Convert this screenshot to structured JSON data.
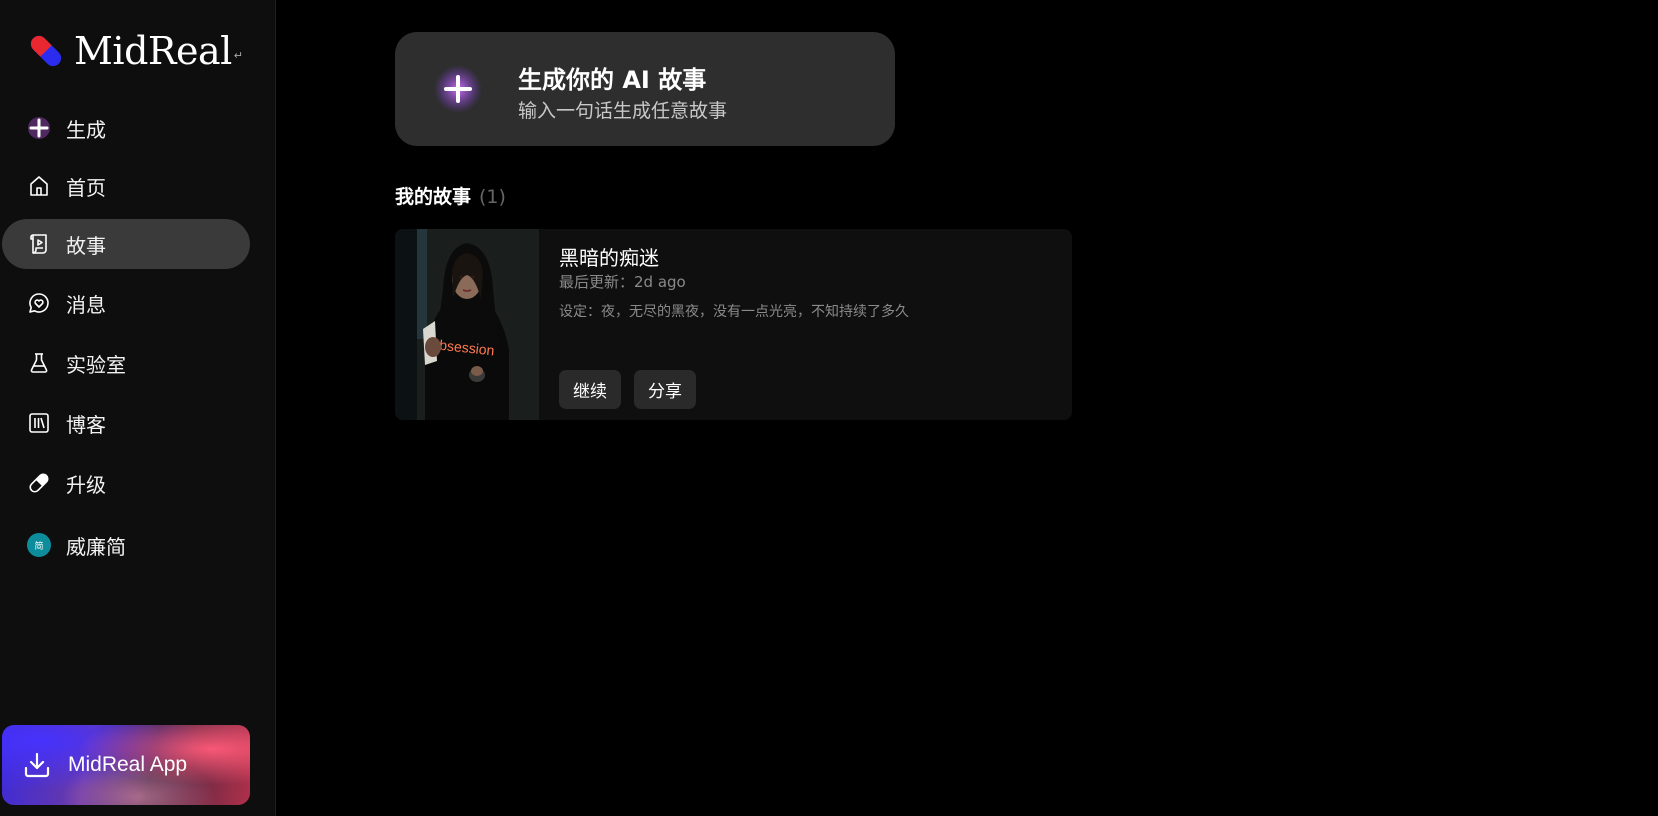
{
  "brand": {
    "logo_text": "MidReal",
    "logo_mark": "↵",
    "pill_colors": [
      "#e8282e",
      "#2c2cf0"
    ]
  },
  "sidebar": {
    "items": [
      {
        "label": "生成",
        "icon": "plus-sparkle-icon"
      },
      {
        "label": "首页",
        "icon": "home-icon"
      },
      {
        "label": "故事",
        "icon": "scroll-icon",
        "active": true
      },
      {
        "label": "消息",
        "icon": "chat-heart-icon"
      },
      {
        "label": "实验室",
        "icon": "flask-icon"
      },
      {
        "label": "博客",
        "icon": "books-icon"
      },
      {
        "label": "升级",
        "icon": "pill-icon"
      },
      {
        "label": "威廉简",
        "icon": "avatar",
        "avatar_text": "简",
        "avatar_color": "#0d8c9c"
      }
    ],
    "app_button": {
      "label": "MidReal App",
      "icon": "download-icon"
    }
  },
  "generate_card": {
    "title": "生成你的 AI 故事",
    "subtitle": "输入一句话生成任意故事"
  },
  "my_stories": {
    "title": "我的故事",
    "count": "(1)",
    "stories": [
      {
        "title": "黑暗的痴迷",
        "updated": "最后更新：2d ago",
        "setting": "设定：夜，无尽的黑夜，没有一点光亮，不知持续了多久",
        "continue_label": "继续",
        "share_label": "分享",
        "thumb_text": "Obsession"
      }
    ]
  },
  "colors": {
    "background": "#000000",
    "sidebar_bg": "#0e0e0e",
    "active_item": "#3a3a3a",
    "card_bg": "#2e2e2e",
    "story_card_bg": "#0f0f0f",
    "button_bg": "#2a2a2a"
  }
}
